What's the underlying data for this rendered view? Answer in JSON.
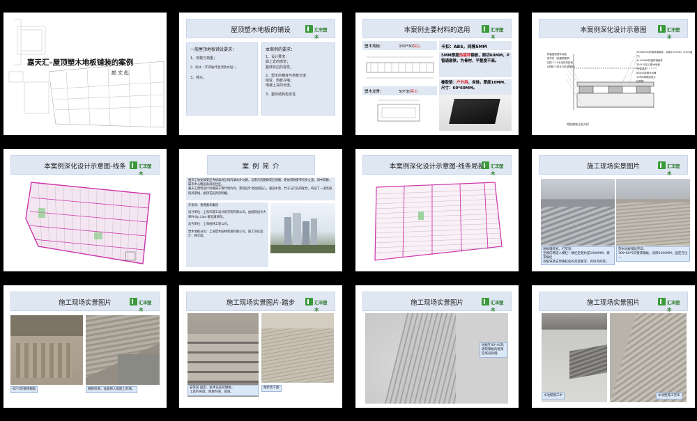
{
  "logo": {
    "text": "汇丰塑木",
    "icon": "leaf-logo-icon"
  },
  "slide1": {
    "title": "嘉天汇–屋顶塑木地板铺装的案例",
    "author": "颜文彪"
  },
  "slide2": {
    "header": "屋顶塑木地板的铺设",
    "left_title": "一般屋顶地板铺设要求：",
    "left_items": [
      "1、荷载与荷重；",
      "2、防水（不得破坏屋顶防水层）；",
      "3、排水。"
    ],
    "right_title": "本案例的要求：",
    "right_items": [
      "1、设计要求：",
      "踩上去的感觉；",
      "整体收边的视觉。",
      "2、塑木的横变与地板长度：",
      "缝变、热胀冷缩；",
      "电梯上货的长度。",
      "3、整体结构稳定性"
    ]
  },
  "slide3": {
    "header": "本案例主要材料的选用",
    "board_label": "塑木地板：",
    "board_size": "150*30",
    "board_size_hl": "实心",
    "clip_text": "卡扣：ABS，间隙5MM",
    "steel_text_pre": "5MM厚度",
    "steel_text_hl": "热镀锌",
    "steel_text_post": "钢板，剪切60MM，P管通扁铁，为骨材，平整度不高。",
    "keel_label": "塑木龙骨：",
    "keel_size": "50*30",
    "keel_size_hl": "实心",
    "rubber_pre": "橡胶垫：",
    "rubber_hl": "户外用",
    "rubber_post": "，含硅，厚度10MM，尺寸：60*60MM。"
  },
  "slide4": {
    "header": "本案例深化设计示意图",
    "notes_left": [
      "预留屋面塑木地板",
      "防护栏（依建筑要求）",
      "加防1:2.5水泥砂浆找坡",
      "(坡度1%排水口处填缝胶)"
    ],
    "notes_right": [
      "300X60X5热镀锌钢扁件，间距1000MM（1500直方）",
      "4x150MM热镀锌钢扁件",
      "150*30实心塑木地板",
      "PE保温层",
      "80X50厚塑木龙骨",
      "10MM厚橡胶垫片",
      "结构层"
    ],
    "bottom_note": "地板铺装立面大样"
  },
  "slide5": {
    "header": "本案例深化设计示意图-线条"
  },
  "slide6": {
    "header": "案 例 简 介",
    "intro": "嘉天汇地处静安区传统高尚区域内兼木外北路，沿南京西路静安区商圈，距地铁静安寺仅步之遥，闹中取静，属市中心精品高尚居住区。",
    "intro2": "嘉天汇建筑设计风格属于现代简约风，景观设计也独具匠心，垂直水景，竹子与灯光的配合，构成了一道亮丽的风景线，屋顶花园亮的明媚。",
    "developer": "开发商：香港嘉华集团",
    "designer": "设计单位：上海市建工设计研究院有限公司，由国际设计大师Philip Liao-廖宜康领衔。",
    "contractor": "总包单位：上海园林工程公司。",
    "sub": "塑木地板分包：上海塑木园林景观有限公司，施工深化设计：顾文彪。"
  },
  "slide7": {
    "header": "本案例深化设计示意图-线条局部"
  },
  "slide8": {
    "header": "施工现场实景图片",
    "cap1": [
      "地板铺装机，打支架：",
      "至横向两道人横栏！横栏定距约是1000MM，要求横栏",
      "有框驾爬支架横栏处的高度要求，有好点的装。"
    ],
    "cap2": [
      "塑木地板铺设完毕。",
      "300*60*5热镀锌钢板，间隙1000MM，固定方位—"
    ]
  },
  "slide9": {
    "header": "施工现场实景图片",
    "cap1": "80*5热镀锌钢板",
    "cap2": "钢管地滑，准备将入底座上的线。"
  },
  "slide10": {
    "header": "施工现场实景图片-踏步",
    "cap1": [
      "安装前 固定，技术员安装钢板，",
      "工具的吊放，防腐剂液，底角。"
    ],
    "cap2": "踏步完工图"
  },
  "slide11": {
    "header": "施工现场实景图片",
    "cap": "地板在40*40热镀锌钢板的框架区域设处理."
  },
  "slide12": {
    "header": "施工现场实景图片",
    "cap1": "水池壁施工中",
    "cap2": "水池壁施工完毕"
  }
}
